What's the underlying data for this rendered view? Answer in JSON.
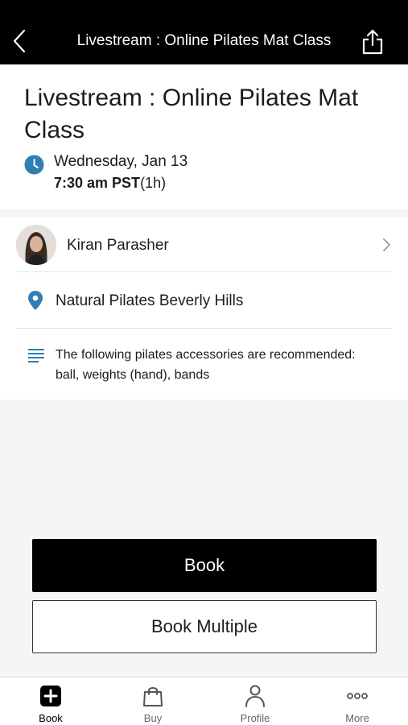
{
  "nav": {
    "title": "Livestream : Online Pilates Mat Class"
  },
  "class": {
    "title": "Livestream : Online Pilates Mat Class",
    "date": "Wednesday, Jan 13",
    "time": "7:30 am PST",
    "duration": "(1h)"
  },
  "instructor": {
    "name": "Kiran Parasher"
  },
  "location": {
    "name": "Natural Pilates Beverly Hills"
  },
  "notes": {
    "text": "The following pilates accessories are recommended: ball, weights (hand), bands"
  },
  "actions": {
    "book_label": "Book",
    "book_multiple_label": "Book Multiple"
  },
  "tabs": [
    {
      "label": "Book",
      "icon": "plus-square-icon"
    },
    {
      "label": "Buy",
      "icon": "shopping-bag-icon"
    },
    {
      "label": "Profile",
      "icon": "person-icon"
    },
    {
      "label": "More",
      "icon": "more-dots-icon"
    }
  ],
  "colors": {
    "accent": "#2f7fb5",
    "primary_button": "#000000",
    "nav_background": "#000000"
  }
}
